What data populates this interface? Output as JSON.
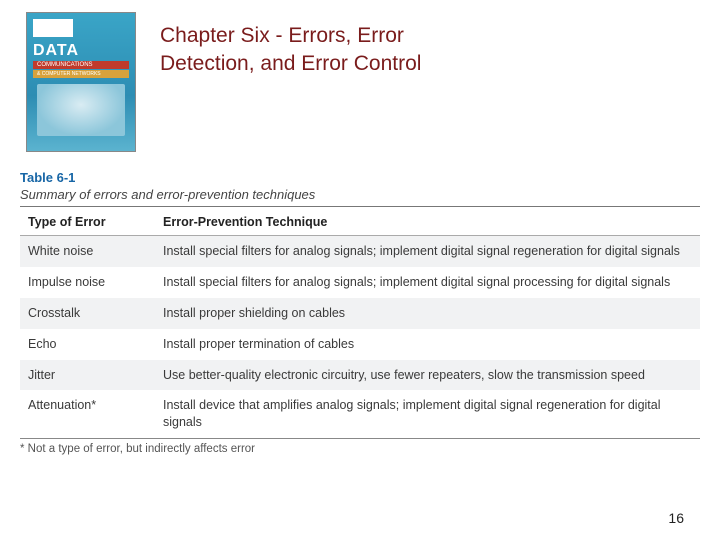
{
  "header": {
    "chapter_title": "Chapter Six - Errors, Error Detection, and Error Control",
    "cover": {
      "topbar": "",
      "main": "DATA",
      "sub1": "COMMUNICATIONS",
      "sub2": "& COMPUTER NETWORKS"
    }
  },
  "table": {
    "label": "Table 6-1",
    "caption": "Summary of errors and error-prevention techniques",
    "columns": [
      "Type of Error",
      "Error-Prevention Technique"
    ],
    "rows": [
      {
        "type": "White noise",
        "tech": "Install special filters for analog signals; implement digital signal regeneration for digital signals"
      },
      {
        "type": "Impulse noise",
        "tech": "Install special filters for analog signals; implement digital signal processing for digital signals"
      },
      {
        "type": "Crosstalk",
        "tech": "Install proper shielding on cables"
      },
      {
        "type": "Echo",
        "tech": "Install proper termination of cables"
      },
      {
        "type": "Jitter",
        "tech": "Use better-quality electronic circuitry, use fewer repeaters, slow the transmission speed"
      },
      {
        "type": "Attenuation*",
        "tech": "Install device that amplifies analog signals; implement digital signal regeneration for digital signals"
      }
    ],
    "footnote": "* Not a type of error, but indirectly affects error"
  },
  "page_number": "16"
}
